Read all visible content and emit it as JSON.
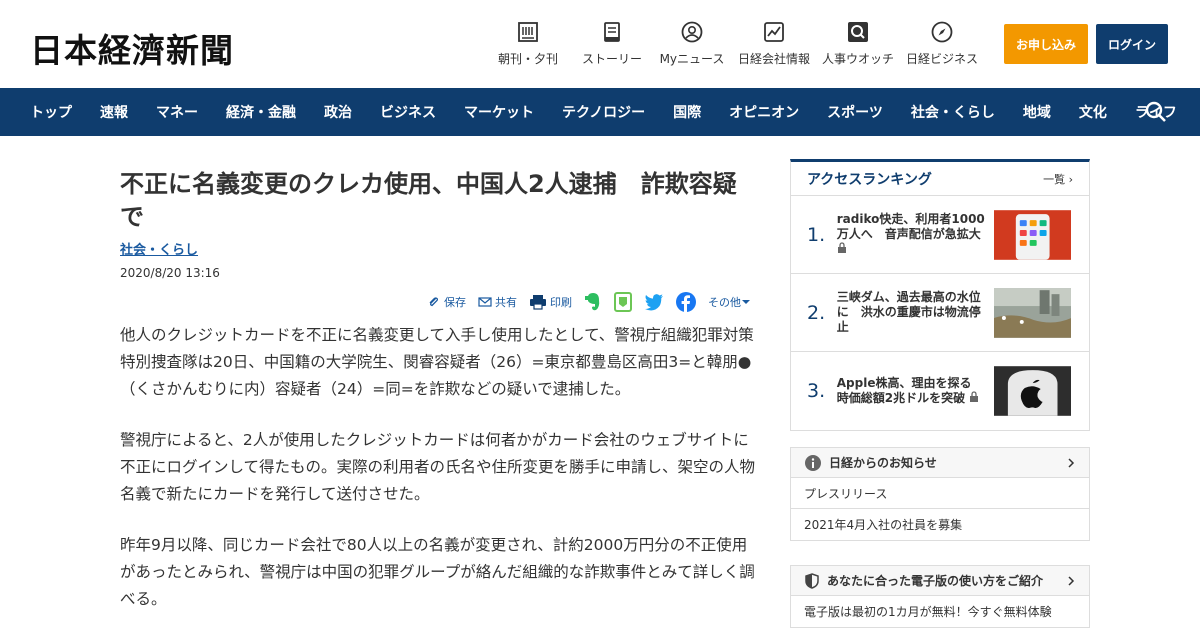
{
  "header": {
    "logo": "日本経濟新聞",
    "icons": [
      {
        "label": "朝刊・夕刊",
        "icon": "newspaper-icon"
      },
      {
        "label": "ストーリー",
        "icon": "book-icon"
      },
      {
        "label": "Myニュース",
        "icon": "user-icon"
      },
      {
        "label": "日経会社情報",
        "icon": "chart-icon"
      },
      {
        "label": "人事ウオッチ",
        "icon": "magnifier-icon"
      },
      {
        "label": "日経ビジネス",
        "icon": "compass-icon"
      }
    ],
    "apply_label": "お申し込み",
    "login_label": "ログイン",
    "colors": {
      "apply": "#f39800",
      "navy": "#0f3d6e"
    }
  },
  "nav": {
    "items": [
      "トップ",
      "速報",
      "マネー",
      "経済・金融",
      "政治",
      "ビジネス",
      "マーケット",
      "テクノロジー",
      "国際",
      "オピニオン",
      "スポーツ",
      "社会・くらし",
      "地域",
      "文化",
      "ライフ"
    ],
    "search_icon": "search-icon"
  },
  "article": {
    "title": "不正に名義変更のクレカ使用、中国人2人逮捕　詐欺容疑で",
    "category": "社会・くらし",
    "date": "2020/8/20 13:16",
    "share": {
      "save": "保存",
      "share": "共有",
      "print": "印刷",
      "more": "その他"
    },
    "paragraphs": [
      "他人のクレジットカードを不正に名義変更して入手し使用したとして、警視庁組織犯罪対策特別捜査隊は20日、中国籍の大学院生、閔睿容疑者（26）=東京都豊島区高田3=と韓朋●（くさかんむりに内）容疑者（24）=同=を詐欺などの疑いで逮捕した。",
      "警視庁によると、2人が使用したクレジットカードは何者かがカード会社のウェブサイトに不正にログインして得たもの。実際の利用者の氏名や住所変更を勝手に申請し、架空の人物名義で新たにカードを発行して送付させた。",
      "昨年9月以降、同じカード会社で80人以上の名義が変更され、計約2000万円分の不正使用があったとみられ、警視庁は中国の犯罪グループが絡んだ組織的な詐欺事件とみて詳しく調べる。"
    ]
  },
  "sidebar": {
    "ranking": {
      "title": "アクセスランキング",
      "more": "一覧",
      "items": [
        {
          "rank": "1.",
          "text": "radiko快走、利用者1000万人へ　音声配信が急拡大"
        },
        {
          "rank": "2.",
          "text": "三峡ダム、過去最高の水位に　洪水の重慶市は物流停止"
        },
        {
          "rank": "3.",
          "text": "Apple株高、理由を探る　時価総額2兆ドルを突破"
        }
      ]
    },
    "notice": {
      "title": "日経からのお知らせ",
      "rows": [
        "プレスリリース",
        "2021年4月入社の社員を募集"
      ]
    },
    "guide": {
      "title": "あなたに合った電子版の使い方をご紹介",
      "rows": [
        "電子版は最初の1カ月が無料！今すぐ無料体験"
      ]
    }
  }
}
